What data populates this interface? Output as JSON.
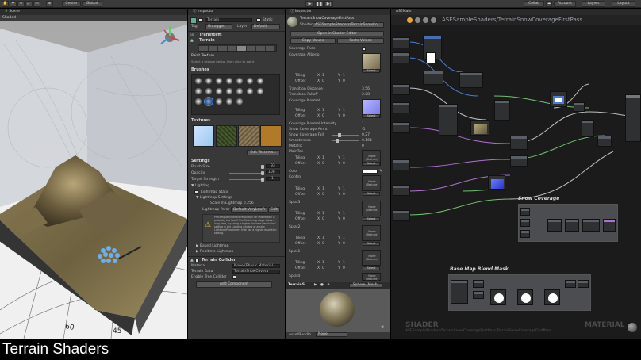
{
  "toolbar": {
    "pivot": "Center",
    "space": "Global",
    "collab": "Collab",
    "account": "Account",
    "layers": "Layers",
    "layout": "Layout"
  },
  "scene": {
    "tab": "Scene",
    "shading": "Shaded",
    "scale_label": "60",
    "scale_label2": "45"
  },
  "inspector1": {
    "tab": "Inspector",
    "object_name": "Terrain",
    "static": "Static",
    "tag_label": "Tag",
    "tag_value": "Untagged",
    "layer_label": "Layer",
    "layer_value": "Default",
    "transform": "Transform",
    "terrain": "Terrain",
    "paint_texture": "Paint Texture",
    "paint_hint": "Select a texture below, then click to paint",
    "brushes": "Brushes",
    "textures": "Textures",
    "edit_textures": "Edit Textures...",
    "settings": "Settings",
    "brush_size_label": "Brush Size",
    "brush_size_value": "93",
    "opacity_label": "Opacity",
    "opacity_value": "100",
    "target_strength_label": "Target Strength",
    "target_strength_value": "1",
    "lighting": "Lighting",
    "lightmap_static": "Lightmap Static",
    "lightmap_settings": "Lightmap Settings",
    "scale_in_lightmap": "Scale In Lightmap 0.256",
    "lightmap_param_label": "Lightmap Parar",
    "lightmap_param_value": "Default-VeryLowR",
    "lightmap_param_btn": "Edit",
    "warning_text": "Precompute/indirect resolution for this terrain is probably too low. If the Clustering stage takes a long time, try using a higher 'Indirect Resolution' setting in the Lighting window or assign LightmapParameters that use a higher resolution setting.",
    "baked_lightmap": "Baked Lightmap",
    "realtime_lightmap": "Realtime Lightmap",
    "terrain_collider": "Terrain Collider",
    "material_label": "Material",
    "material_value": "None (Physic Material",
    "terrain_data_label": "Terrain Data",
    "terrain_data_value": "TerrainSnowCovera",
    "enable_tree_label": "Enable Tree Collider",
    "add_component": "Add Component"
  },
  "inspector2": {
    "tab": "Inspector",
    "material_name": "TerrainSnowCoverageFirstPass",
    "shader_label": "Shader",
    "shader_value": "ASESampleShaders/TerrainSnowCo",
    "open_shader_editor": "Open in Shader Editor",
    "copy_values": "Copy Values",
    "paste_values": "Paste Values",
    "coverage_fade": "Coverage Fade",
    "coverage_albedo": "Coverage Albedo",
    "tiling": "Tiling",
    "offset": "Offset",
    "x": "X",
    "y": "Y",
    "one": "1",
    "zero": "0",
    "select": "Select",
    "transition_distance_label": "Transition Distance",
    "transition_distance_value": "3.56",
    "transition_falloff_label": "Transition Falloff",
    "transition_falloff_value": "2.08",
    "coverage_normal": "Coverage Normal",
    "coverage_normal_intensity_label": "Coverage Normal Intensity",
    "coverage_normal_intensity_value": "1",
    "snow_coverage_amnt_label": "Snow Coverage Amnt",
    "snow_coverage_amnt_value": "-1",
    "snow_coverage_fall_label": "Snow Coverage Fall",
    "snow_coverage_fall_value": "0.27",
    "smoothness_label": "Smoothness",
    "smoothness_value": "0.164",
    "metallic_label": "Metallic",
    "metallic_value": "0",
    "maintex": "MainTex",
    "none_texture": "None (Texture)",
    "color": "Color",
    "control": "Control",
    "splat3": "Splat3",
    "splat2": "Splat2",
    "splat1": "Splat1",
    "splat0": "Splat0",
    "preview_label": "TerrainS",
    "preview_mode": "Sphere (Mesh)",
    "assetbundle_label": "AssetBundle",
    "assetbundle_value": "None"
  },
  "graph": {
    "tab": "ASEMain",
    "path": "ASESampleShaders/TerrainSnowCoverageFirstPass",
    "snow_coverage": "Snow Coverage",
    "base_map_blend_mask": "Base Map Blend Mask",
    "footer_shader": "SHADER",
    "footer_material": "MATERIAL",
    "footer_path": "ASESampleShaders/TerrainSnowCoverageFirstPass  TerrainSnowCoverageFirstPass"
  },
  "caption": "Terrain Shaders",
  "colors": {
    "unity_panel": "#383838",
    "graph_bg": "#1b1b1b",
    "accent_blue": "#3a7bd5"
  }
}
